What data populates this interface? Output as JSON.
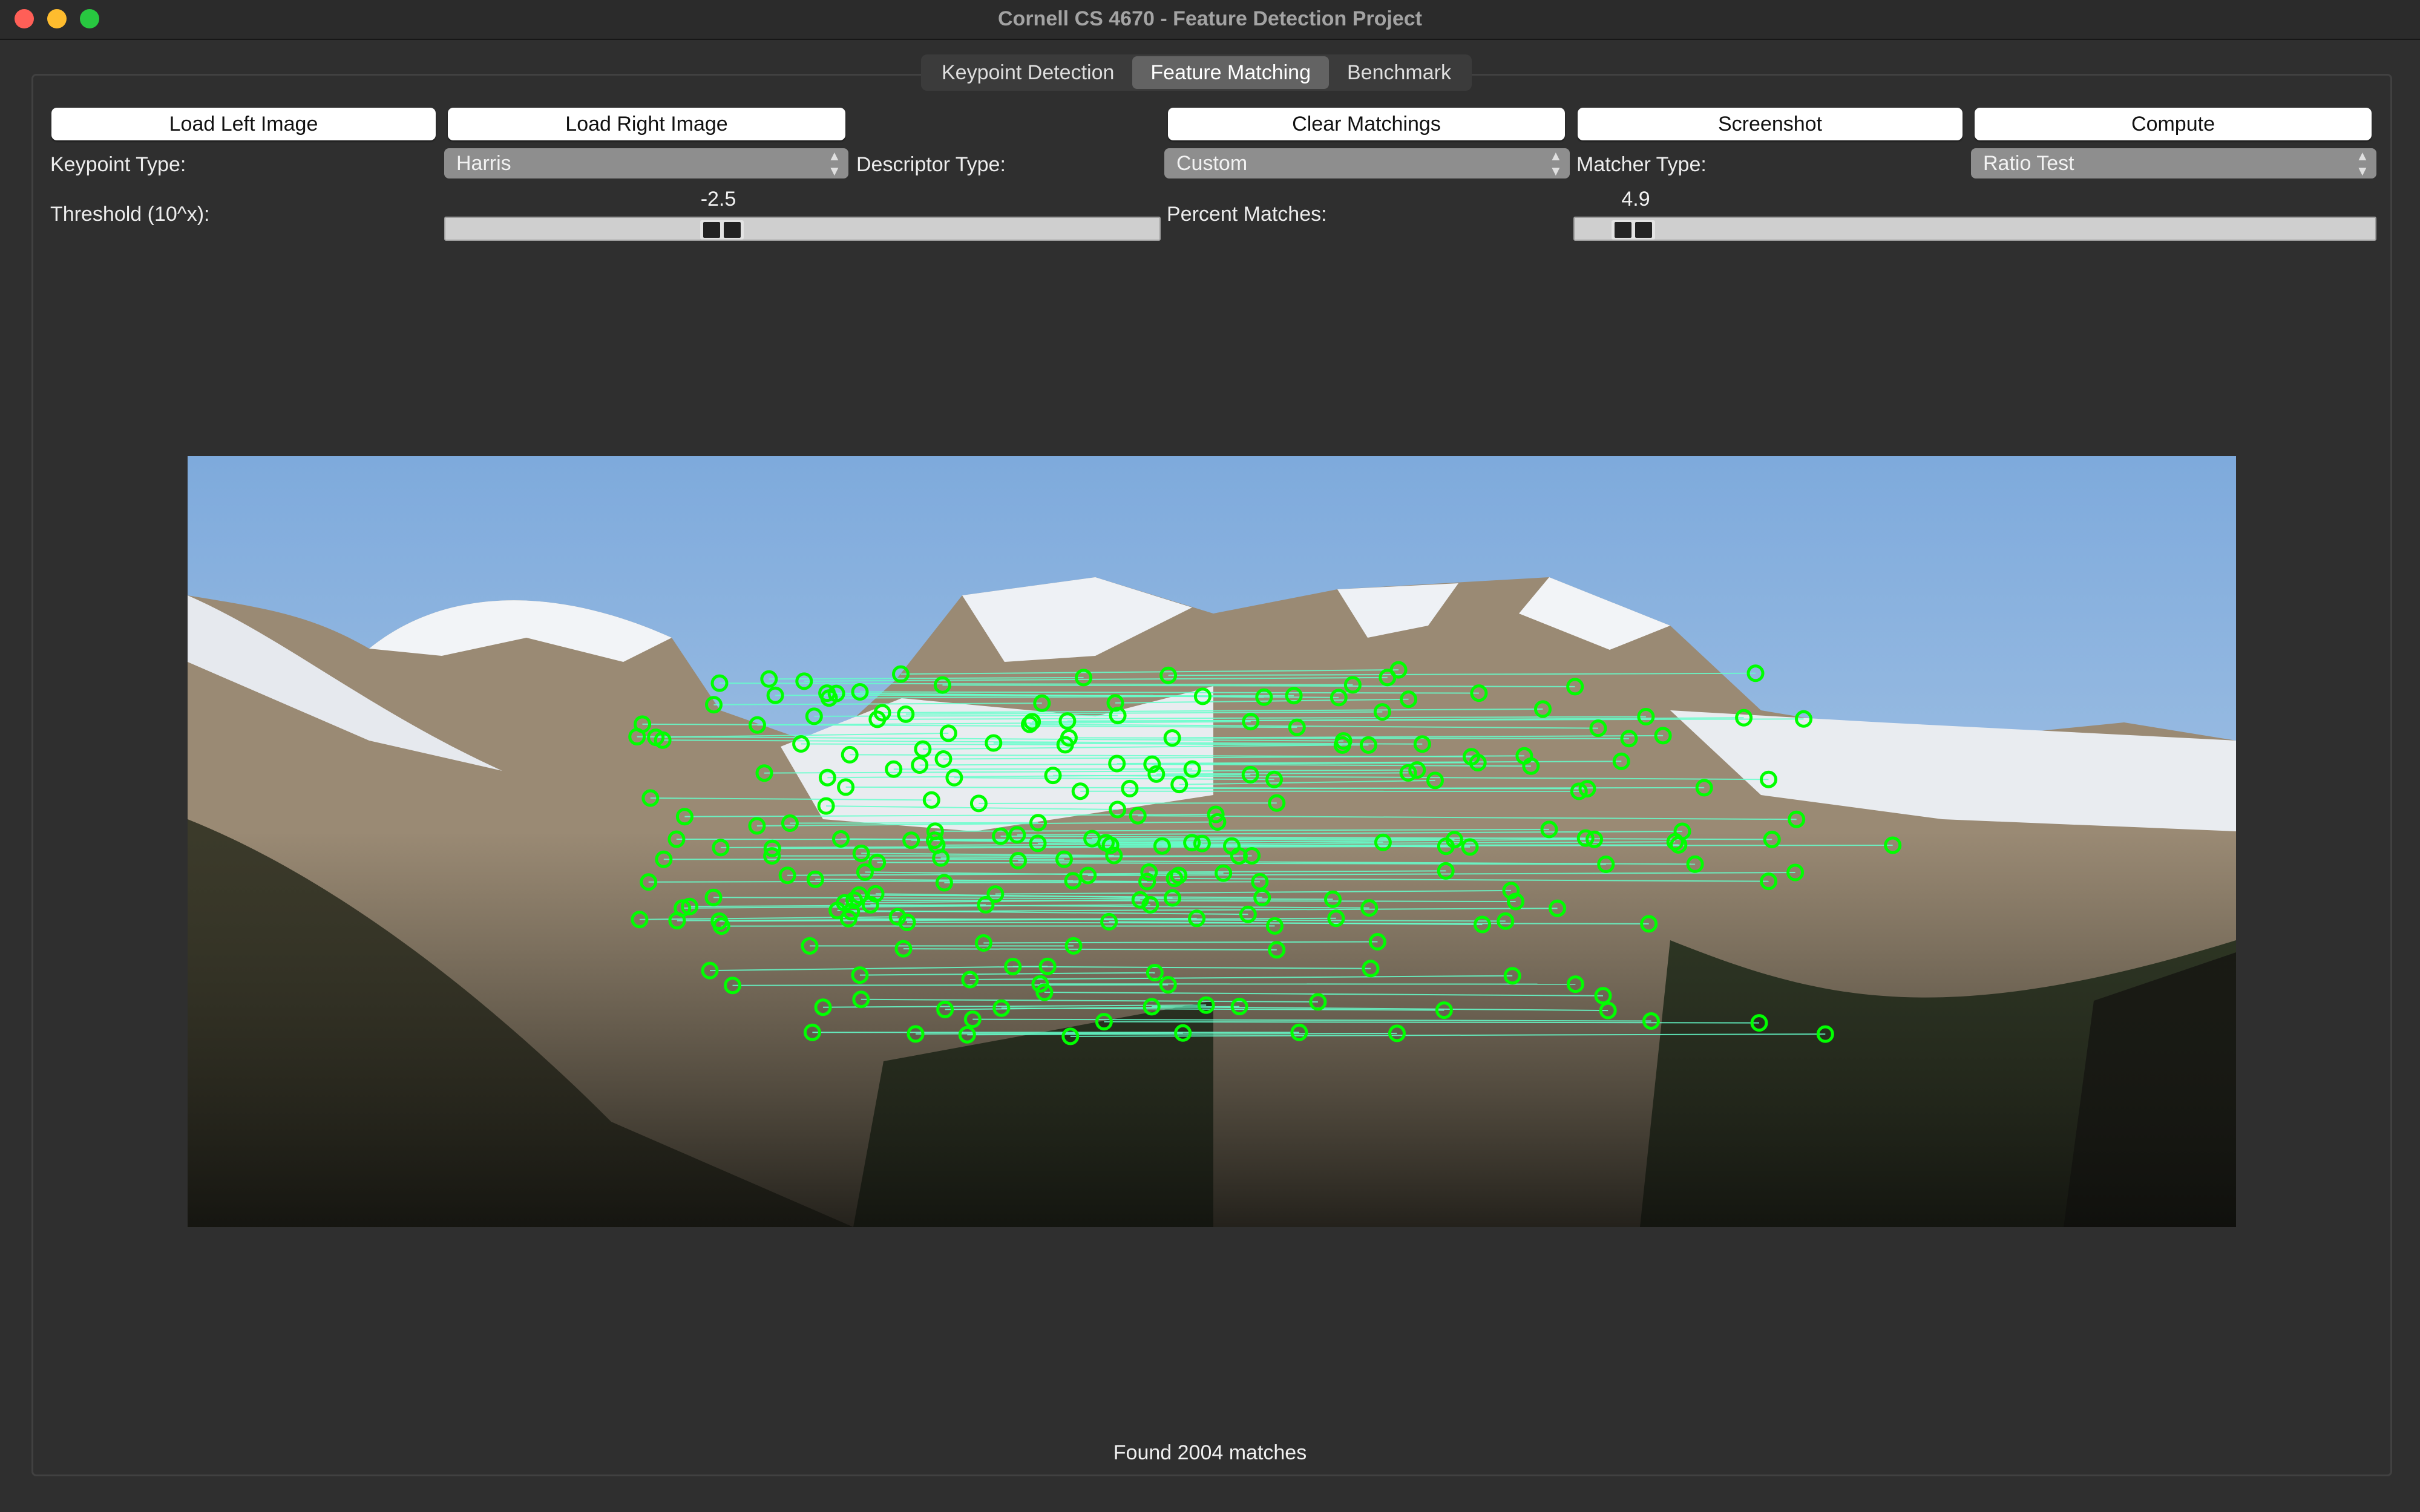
{
  "window": {
    "title": "Cornell CS 4670 - Feature Detection Project"
  },
  "tabs": [
    {
      "label": "Keypoint Detection",
      "active": false
    },
    {
      "label": "Feature Matching",
      "active": true
    },
    {
      "label": "Benchmark",
      "active": false
    }
  ],
  "toolbar": {
    "load_left": "Load Left Image",
    "load_right": "Load Right Image",
    "clear": "Clear Matchings",
    "screenshot": "Screenshot",
    "compute": "Compute"
  },
  "keypoint_type": {
    "label": "Keypoint Type:",
    "value": "Harris"
  },
  "descriptor_type": {
    "label": "Descriptor Type:",
    "value": "Custom"
  },
  "matcher_type": {
    "label": "Matcher Type:",
    "value": "Ratio Test"
  },
  "threshold": {
    "label": "Threshold (10^x):",
    "value": "-2.5",
    "fraction": 0.38
  },
  "percent_matches": {
    "label": "Percent Matches:",
    "value": "4.9",
    "fraction": 0.049
  },
  "status": {
    "text": "Found 2004 matches"
  },
  "colors": {
    "keypoint": "#00ff00",
    "match_line": "#66ffcc",
    "sky_top": "#86b2de",
    "rock": "#8a7c6a",
    "snow": "#f1f3f6"
  }
}
